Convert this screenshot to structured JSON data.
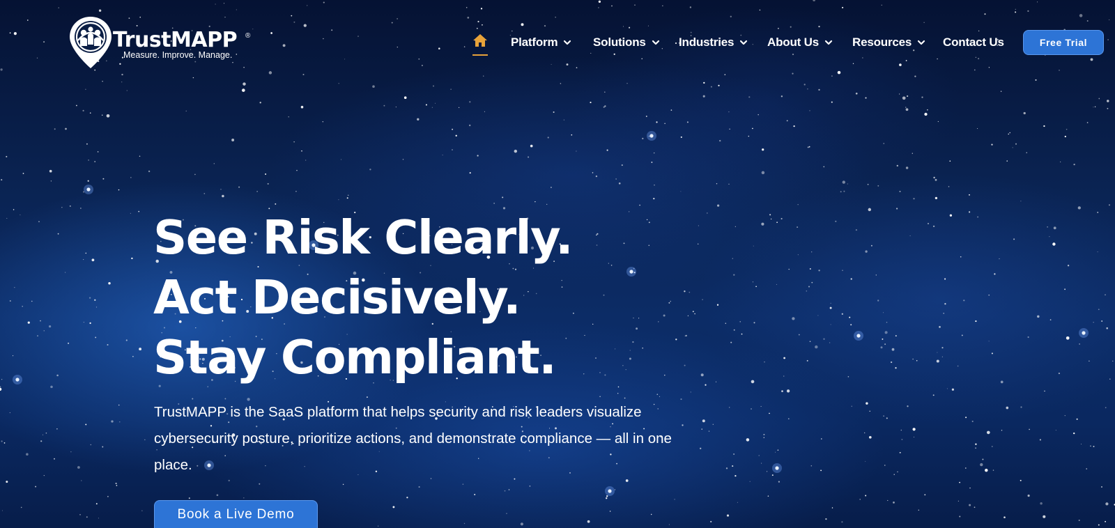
{
  "brand": {
    "name": "TrustMAPP",
    "registered_mark": "®",
    "tagline": "Measure. Improve. Manage."
  },
  "nav": {
    "home_icon": "home-icon",
    "items": [
      {
        "label": "Platform",
        "icon": "chevron-down-icon"
      },
      {
        "label": "Solutions",
        "icon": "chevron-down-icon"
      },
      {
        "label": "Industries",
        "icon": "chevron-down-icon"
      },
      {
        "label": "About Us",
        "icon": "chevron-down-icon"
      },
      {
        "label": "Resources",
        "icon": "chevron-down-icon"
      },
      {
        "label": "Contact Us"
      }
    ],
    "cta_label": "Free Trial"
  },
  "hero": {
    "title_lines": [
      "See Risk Clearly.",
      "Act Decisively.",
      "Stay Compliant."
    ],
    "description": "TrustMAPP is the SaaS platform that helps security and risk leaders visualize cybersecurity posture, prioritize actions, and demonstrate compliance — all in one place.",
    "cta_label": "Book a Live Demo"
  },
  "colors": {
    "accent_blue": "#2d74d6",
    "home_icon": "#e8a33a",
    "background": "#0a2352"
  }
}
